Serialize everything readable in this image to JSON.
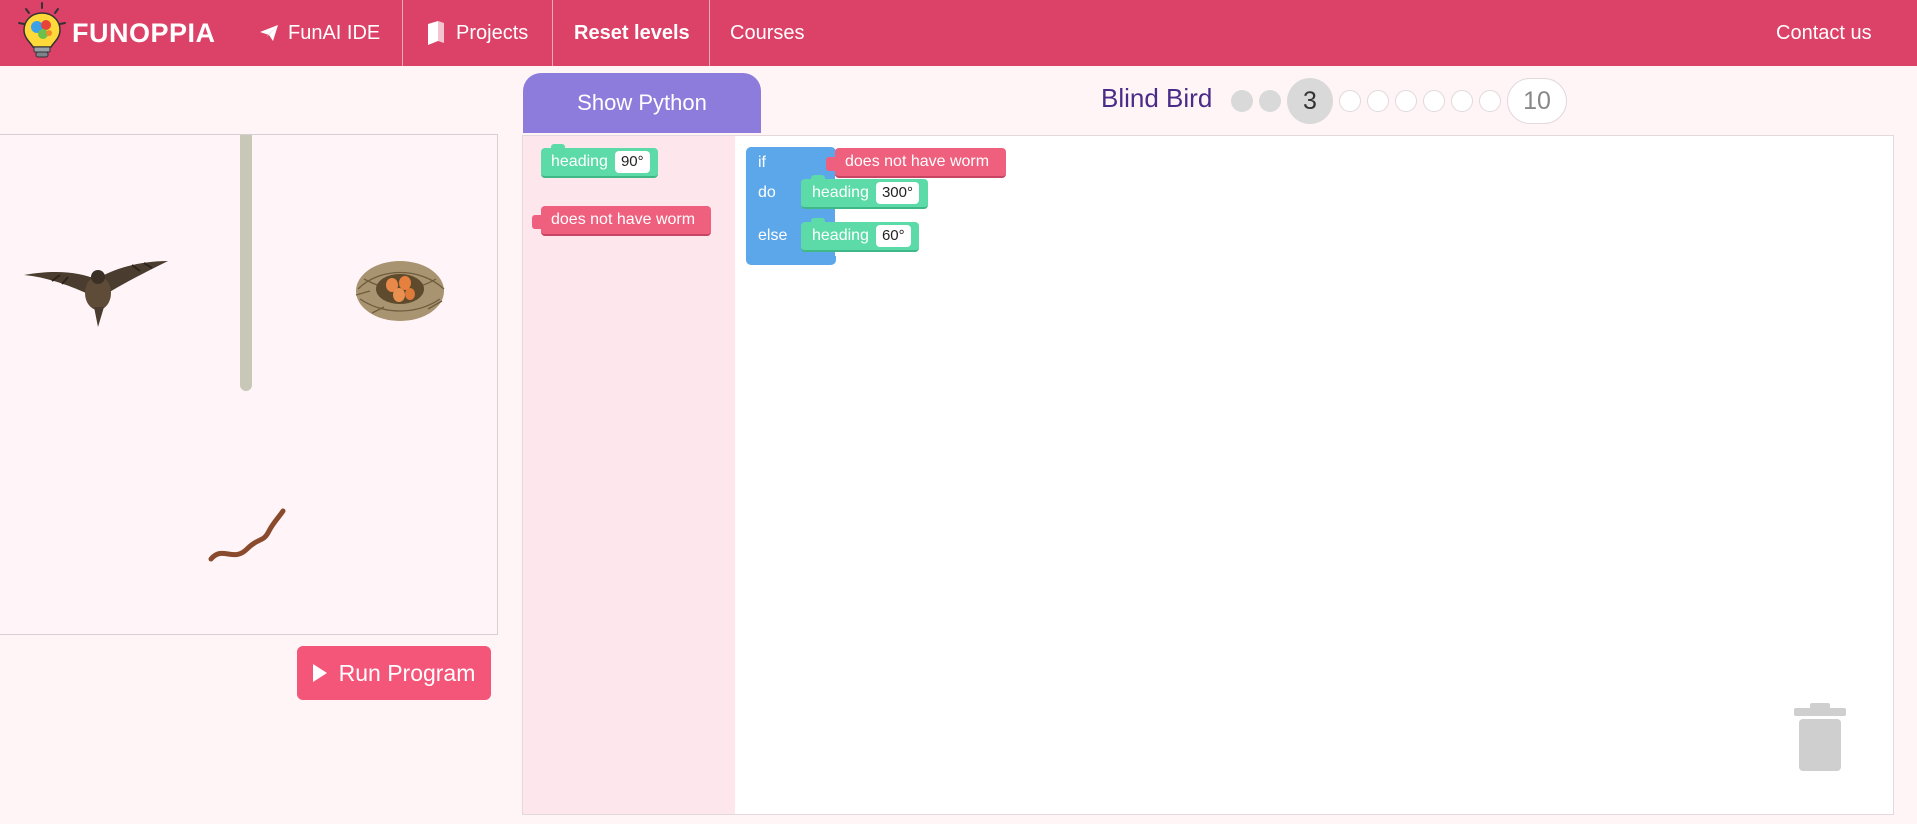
{
  "brand": {
    "name": "FUNOPPIA"
  },
  "nav": {
    "ide": "FunAI IDE",
    "projects": "Projects",
    "reset": "Reset levels",
    "courses": "Courses",
    "contact": "Contact us"
  },
  "stage": {
    "run_label": "Run Program"
  },
  "editor": {
    "show_python": "Show Python",
    "level_title": "Blind Bird",
    "level_current": "3",
    "level_last": "10",
    "levels_total": 10,
    "levels_completed": 2
  },
  "toolbox": {
    "heading_label": "heading",
    "heading_value": "90°",
    "condition_label": "does not have worm"
  },
  "workspace": {
    "if_label": "if",
    "do_label": "do",
    "else_label": "else",
    "condition_label": "does not have worm",
    "do_heading_label": "heading",
    "do_heading_value": "300°",
    "else_heading_label": "heading",
    "else_heading_value": "60°"
  },
  "colors": {
    "nav_bg": "#dc4168",
    "run_button": "#f4567a",
    "show_python": "#8e7cdc",
    "block_green": "#5cdba8",
    "block_pink": "#ef5f7e",
    "block_blue": "#5ba7ea"
  },
  "icons": [
    "lightbulb-logo-icon",
    "paper-plane-icon",
    "book-icon",
    "play-icon",
    "trash-icon"
  ]
}
